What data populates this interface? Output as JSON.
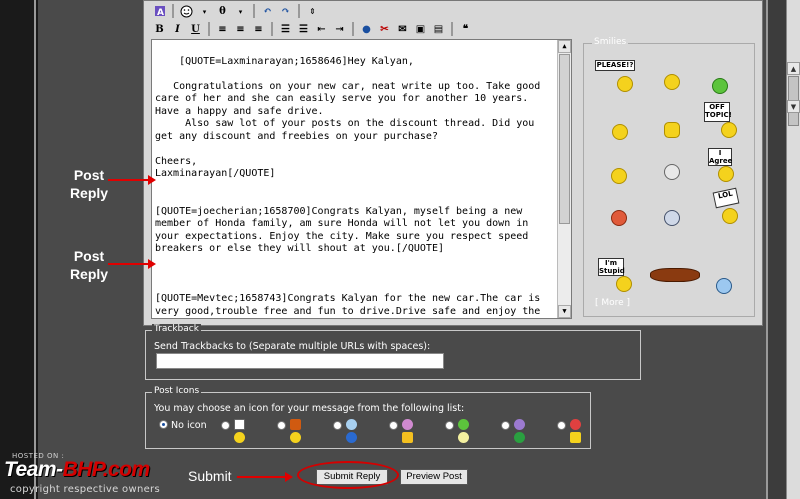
{
  "toolbar": {
    "row1": [
      "hand-icon",
      "smiley-icon",
      "emoticon-icon",
      "sort-icon",
      "undo-icon",
      "redo-icon",
      "updown-icon"
    ],
    "row2_labels": {
      "bold": "B",
      "italic": "I",
      "underline": "U"
    }
  },
  "editor": {
    "text": "[QUOTE=Laxminarayan;1658646]Hey Kalyan,\n\n   Congratulations on your new car, neat write up too. Take good care of her and she can easily serve you for another 10 years. Have a happy and safe drive.\n     Also saw lot of your posts on the discount thread. Did you get any discount and freebies on your purchase?\n\nCheers,\nLaxminarayan[/QUOTE]\n\n\n[QUOTE=joecherian;1658700]Congrats Kalyan, myself being a new member of Honda family, am sure Honda will not let you down in your expectations. Enjoy the city. Make sure you respect speed breakers or else they will shout at you.[/QUOTE]\n\n\n\n[QUOTE=Mevtec;1658743]Congrats Kalyan for the new car.The car is very good,trouble free and fun to drive.Drive safe and enjoy the car.[/QUOTE]"
  },
  "smilies": {
    "legend": "Smilies",
    "more_link": "[ More ]",
    "signs": {
      "please": "PLEASE!?",
      "off_topic": "OFF TOPIC!",
      "i_agree": "I Agree",
      "lol": "LOL",
      "im_stupid": "I'm Stupid"
    }
  },
  "trackback": {
    "legend": "Trackback",
    "instruction": "Send Trackbacks to (Separate multiple URLs with spaces):",
    "value": ""
  },
  "post_icons": {
    "legend": "Post Icons",
    "instruction": "You may choose an icon for your message from the following list:",
    "no_icon_label": "No icon",
    "selected": "No icon"
  },
  "buttons": {
    "submit": "Submit Reply",
    "preview": "Preview Post"
  },
  "annotations": {
    "post_reply_1": "Post\nReply",
    "post_reply_2": "Post\nReply",
    "submit": "Submit"
  },
  "watermark": {
    "hosted": "HOSTED ON :",
    "logo_team": "Team-",
    "logo_bhp": "BHP.com",
    "copyright": "copyright respective owners"
  },
  "colors": {
    "accent_red": "#d40000",
    "panel_bg": "#d8d8d8",
    "page_bg": "#4a4a4a"
  }
}
